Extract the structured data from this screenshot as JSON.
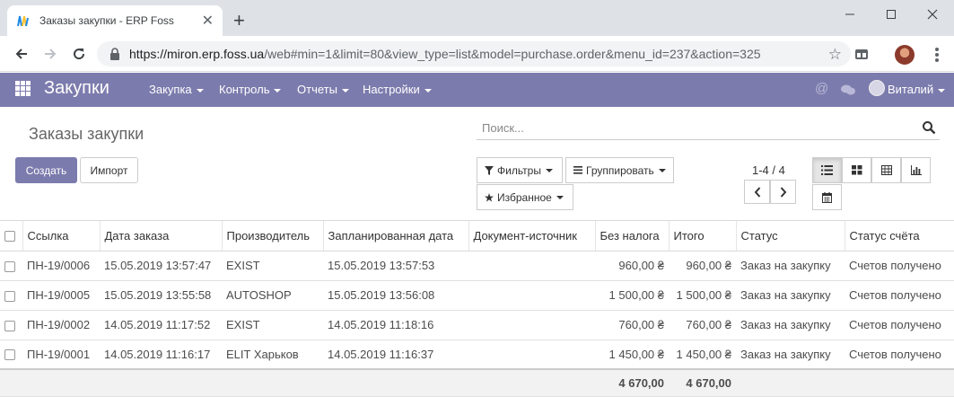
{
  "browser": {
    "tab_title": "Заказы закупки - ERP Foss",
    "url_host": "https://miron.erp.foss.ua",
    "url_rest": "/web#min=1&limit=80&view_type=list&model=purchase.order&menu_id=237&action=325"
  },
  "app": {
    "name": "Закупки",
    "menu": [
      "Закупка",
      "Контроль",
      "Отчеты",
      "Настройки"
    ],
    "user": "Виталий",
    "accent_color": "#7c7bad"
  },
  "panel": {
    "breadcrumb": "Заказы закупки",
    "search_placeholder": "Поиск...",
    "create_label": "Создать",
    "import_label": "Импорт",
    "filters_label": "Фильтры",
    "groupby_label": "Группировать",
    "favorites_label": "Избранное",
    "pager": "1-4 / 4"
  },
  "table": {
    "columns": [
      "Ссылка",
      "Дата заказа",
      "Производитель",
      "Запланированная дата",
      "Документ-источник",
      "Без налога",
      "Итого",
      "Статус",
      "Статус счёта"
    ],
    "rows": [
      [
        "ПН-19/0006",
        "15.05.2019 13:57:47",
        "EXIST",
        "15.05.2019 13:57:53",
        "",
        "960,00 ₴",
        "960,00 ₴",
        "Заказ на закупку",
        "Счетов получено"
      ],
      [
        "ПН-19/0005",
        "15.05.2019 13:55:58",
        "AUTOSHOP",
        "15.05.2019 13:56:08",
        "",
        "1 500,00 ₴",
        "1 500,00 ₴",
        "Заказ на закупку",
        "Счетов получено"
      ],
      [
        "ПН-19/0002",
        "14.05.2019 11:17:52",
        "EXIST",
        "14.05.2019 11:18:16",
        "",
        "760,00 ₴",
        "760,00 ₴",
        "Заказ на закупку",
        "Счетов получено"
      ],
      [
        "ПН-19/0001",
        "14.05.2019 11:16:17",
        "ELIT Харьков",
        "14.05.2019 11:16:37",
        "",
        "1 450,00 ₴",
        "1 450,00 ₴",
        "Заказ на закупку",
        "Счетов получено"
      ]
    ],
    "totals": {
      "untaxed": "4 670,00",
      "total": "4 670,00"
    }
  }
}
